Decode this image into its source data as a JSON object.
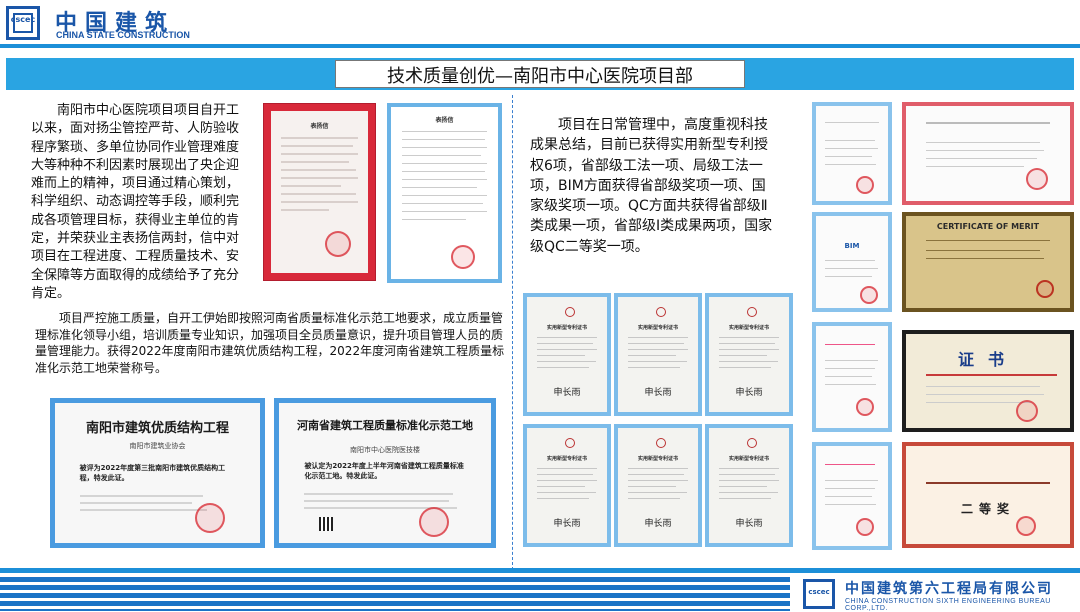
{
  "header": {
    "logo_text": "cscec",
    "company_cn": "中国建筑",
    "company_en": "CHINA STATE CONSTRUCTION"
  },
  "title": "技术质量创优—南阳市中心医院项目部",
  "paragraphs": {
    "p1": "南阳市中心医院项目项目自开工以来，面对扬尘管控严苛、人防验收程序繁琐、多单位协同作业管理难度大等种种不利因素时展现出了央企迎难而上的精神，项目通过精心策划，科学组织、动态调控等手段，顺利完成各项管理目标，获得业主单位的肯定，并荣获业主表扬信两封，信中对项目在工程进度、工程质量技术、安全保障等方面取得的成绩给予了充分肯定。",
    "p2": "项目严控施工质量，自开工伊始即按照河南省质量标准化示范工地要求，成立质量管理标准化领导小组，培训质量专业知识，加强项目全员质量意识，提升项目管理人员的质量管理能力。获得2022年度南阳市建筑优质结构工程，2022年度河南省建筑工程质量标准化示范工地荣誉称号。",
    "p3": "项目在日常管理中，高度重视科技成果总结，目前已获得实用新型专利授权6项，省部级工法一项、局级工法一项，BIM方面获得省部级奖项一项、国家级奖项一项。QC方面共获得省部级Ⅱ类成果一项，省部级Ⅰ类成果两项，国家级QC二等奖一项。"
  },
  "letters": {
    "red_letter_title": "表扬信",
    "letter_title": "表扬信"
  },
  "certificates": {
    "nanyang": {
      "title": "南阳市建筑优质结构工程",
      "subtitle": "南阳市建筑业协会",
      "body": "被评为2022年度第三批南阳市建筑优质结构工程，特发此证。"
    },
    "henan": {
      "title": "河南省建筑工程质量标准化示范工地",
      "subtitle": "南阳市中心医院医技楼",
      "body": "被认定为2022年度上半年河南省建筑工程质量标准化示范工地。特发此证。"
    }
  },
  "patent": {
    "title": "实用新型专利证书",
    "signature": "申长雨"
  },
  "right_certs": {
    "merit": "CERTIFICATE OF MERIT",
    "honor": "证书",
    "second_prize": "二等奖"
  },
  "footer": {
    "logo_text": "cscec",
    "company_cn": "中国建筑第六工程局有限公司",
    "company_en": "CHINA CONSTRUCTION SIXTH ENGINEERING BUREAU CORP.,LTD."
  },
  "colors": {
    "brand_blue": "#1a56a8",
    "title_bar": "#2aa4e2",
    "frame_blue": "#4a9be0",
    "letter_red": "#d8293a"
  }
}
